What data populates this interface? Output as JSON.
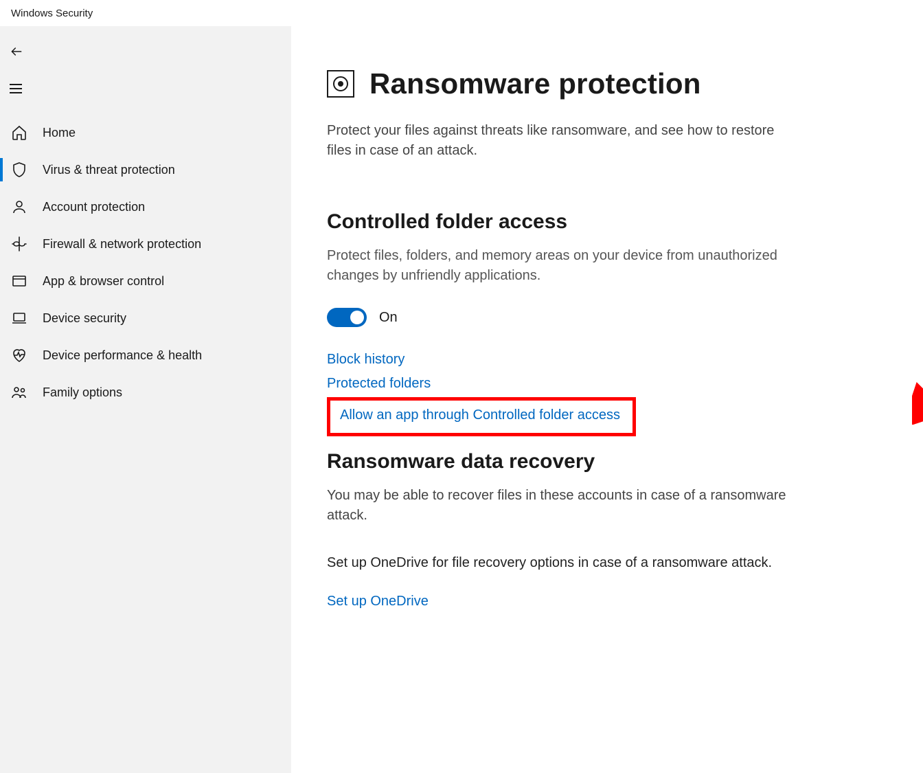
{
  "app": {
    "title": "Windows Security"
  },
  "sidebar": {
    "items": [
      {
        "label": "Home"
      },
      {
        "label": "Virus & threat protection"
      },
      {
        "label": "Account protection"
      },
      {
        "label": "Firewall & network protection"
      },
      {
        "label": "App & browser control"
      },
      {
        "label": "Device security"
      },
      {
        "label": "Device performance & health"
      },
      {
        "label": "Family options"
      }
    ]
  },
  "page": {
    "title": "Ransomware protection",
    "intro": "Protect your files against threats like ransomware, and see how to restore files in case of an attack."
  },
  "cfa": {
    "heading": "Controlled folder access",
    "desc": "Protect files, folders, and memory areas on your device from unauthorized changes by unfriendly applications.",
    "toggle_state": "On",
    "links": {
      "block_history": "Block history",
      "protected_folders": "Protected folders",
      "allow_app": "Allow an app through Controlled folder access"
    }
  },
  "recovery": {
    "heading": "Ransomware data recovery",
    "desc": "You may be able to recover files in these accounts in case of a ransomware attack.",
    "setup_text": "Set up OneDrive for file recovery options in case of a ransomware attack.",
    "setup_link": "Set up OneDrive"
  }
}
